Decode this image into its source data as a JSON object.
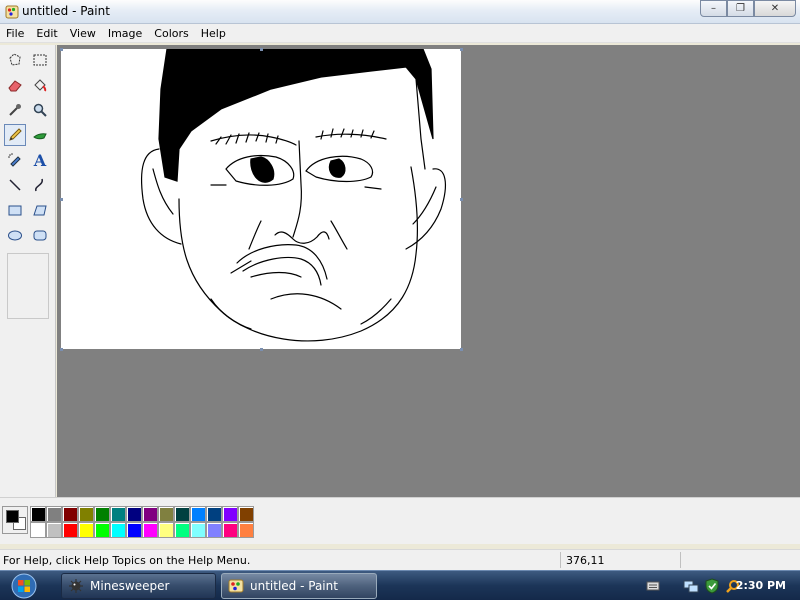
{
  "window": {
    "title": "untitled - Paint",
    "minimize_label": "–",
    "maximize_label": "❐",
    "close_label": "✕"
  },
  "menu": [
    "File",
    "Edit",
    "View",
    "Image",
    "Colors",
    "Help"
  ],
  "tools": [
    {
      "name": "free-form-select",
      "icon": "lasso-icon"
    },
    {
      "name": "select",
      "icon": "rect-select-icon"
    },
    {
      "name": "eraser",
      "icon": "eraser-icon"
    },
    {
      "name": "fill-with-color",
      "icon": "paint-bucket-icon"
    },
    {
      "name": "pick-color",
      "icon": "eyedropper-icon"
    },
    {
      "name": "magnifier",
      "icon": "magnifier-icon"
    },
    {
      "name": "pencil",
      "icon": "pencil-icon",
      "selected": true
    },
    {
      "name": "brush",
      "icon": "brush-icon"
    },
    {
      "name": "airbrush",
      "icon": "airbrush-icon"
    },
    {
      "name": "text",
      "icon": "text-icon",
      "glyph": "A"
    },
    {
      "name": "line",
      "icon": "line-icon"
    },
    {
      "name": "curve",
      "icon": "curve-icon"
    },
    {
      "name": "rectangle",
      "icon": "rectangle-icon"
    },
    {
      "name": "polygon",
      "icon": "polygon-icon"
    },
    {
      "name": "ellipse",
      "icon": "ellipse-icon"
    },
    {
      "name": "rounded-rectangle",
      "icon": "rounded-rect-icon"
    }
  ],
  "palette": {
    "foreground": "#000000",
    "background": "#ffffff",
    "row1": [
      "#000000",
      "#808080",
      "#800000",
      "#808000",
      "#008000",
      "#008080",
      "#000080",
      "#800080",
      "#808040",
      "#004040",
      "#0080ff",
      "#004080",
      "#8000ff",
      "#804000"
    ],
    "row2": [
      "#ffffff",
      "#c0c0c0",
      "#ff0000",
      "#ffff00",
      "#00ff00",
      "#00ffff",
      "#0000ff",
      "#ff00ff",
      "#ffff80",
      "#00ff80",
      "#80ffff",
      "#8080ff",
      "#ff0080",
      "#ff8040"
    ]
  },
  "status": {
    "help_text": "For Help, click Help Topics on the Help Menu.",
    "coordinates": "376,11"
  },
  "taskbar": {
    "buttons": [
      {
        "label": "Minesweeper",
        "icon": "mine-icon",
        "active": false
      },
      {
        "label": "untitled - Paint",
        "icon": "paint-icon",
        "active": true
      }
    ],
    "tray_icons": [
      "keyboard-icon",
      "network-icon",
      "shield-icon",
      "search-icon"
    ],
    "clock": "2:30 PM"
  },
  "colors": {
    "workspace": "#808080",
    "canvas": "#ffffff",
    "taskbar": "#1c3558"
  }
}
